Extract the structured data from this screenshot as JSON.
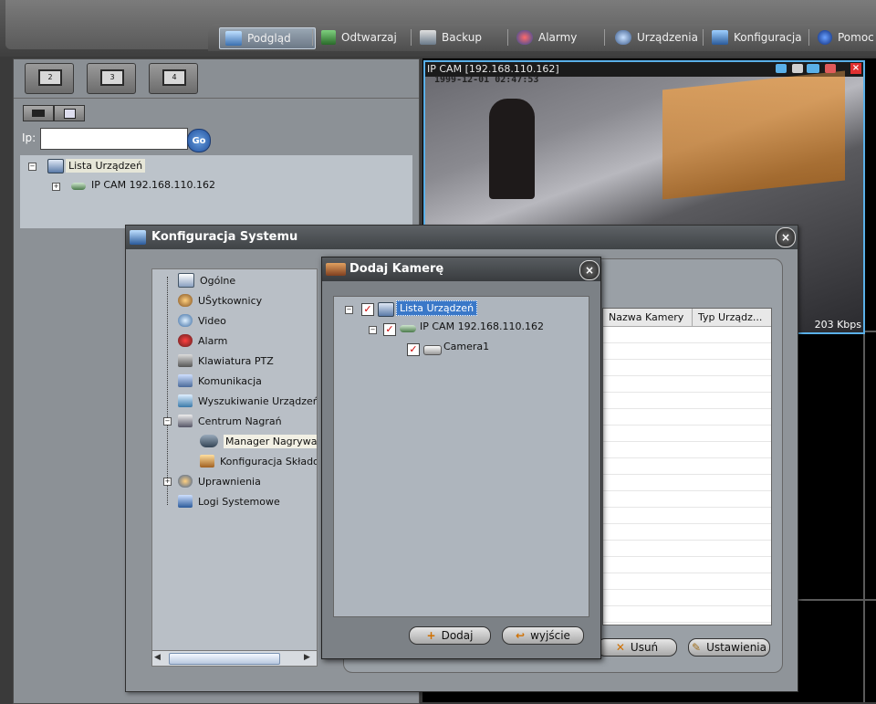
{
  "menu": {
    "items": [
      {
        "label": "Podgląd",
        "icon": "monitor-icon",
        "active": true
      },
      {
        "label": "Odtwarzaj",
        "icon": "film-icon"
      },
      {
        "label": "Backup",
        "icon": "backup-icon"
      },
      {
        "label": "Alarmy",
        "icon": "alarm-icon"
      },
      {
        "label": "Urządzenia",
        "icon": "gear-icon"
      },
      {
        "label": "Konfiguracja",
        "icon": "config-monitor-icon"
      },
      {
        "label": "Pomoc",
        "icon": "help-icon"
      }
    ]
  },
  "left": {
    "layout_buttons": [
      "2",
      "3",
      "4"
    ],
    "ip_label": "Ip:",
    "ip_value": "",
    "go_label": "Go",
    "tree_root": "Lista Urządzeń",
    "tree_child": "IP CAM 192.168.110.162"
  },
  "camera": {
    "title": "IP CAM [192.168.110.162]",
    "osd_time": "1999-12-01  02:47:53",
    "bitrate": "203 Kbps"
  },
  "config": {
    "title": "Konfiguracja Systemu",
    "tree": [
      {
        "label": "Ogólne",
        "icon": "general-icon"
      },
      {
        "label": "UŜytkownicy",
        "icon": "users-icon"
      },
      {
        "label": "Video",
        "icon": "video-icon"
      },
      {
        "label": "Alarm",
        "icon": "alarm-icon"
      },
      {
        "label": "Klawiatura PTZ",
        "icon": "ptz-keyboard-icon"
      },
      {
        "label": "Komunikacja",
        "icon": "network-icon"
      },
      {
        "label": "Wyszukiwanie Urządzeń",
        "icon": "device-search-icon"
      },
      {
        "label": "Centrum Nagrań",
        "icon": "recording-center-icon"
      },
      {
        "label": "Manager Nagrywania",
        "icon": "recording-manager-icon"
      },
      {
        "label": "Konfiguracja Składow",
        "icon": "storage-config-icon"
      },
      {
        "label": "Uprawnienia",
        "icon": "permissions-icon"
      },
      {
        "label": "Logi Systemowe",
        "icon": "logs-icon"
      }
    ],
    "table_headers": [
      "Nazwa Kamery",
      "Typ Urządz..."
    ],
    "buttons": {
      "usun": "Usuń",
      "ustawienia": "Ustawienia"
    }
  },
  "dodaj": {
    "title": "Dodaj Kamerę",
    "tree": {
      "root": "Lista Urządzeń",
      "device": "IP CAM 192.168.110.162",
      "camera": "Camera1"
    },
    "buttons": {
      "add": "Dodaj",
      "exit": "wyjście"
    }
  }
}
